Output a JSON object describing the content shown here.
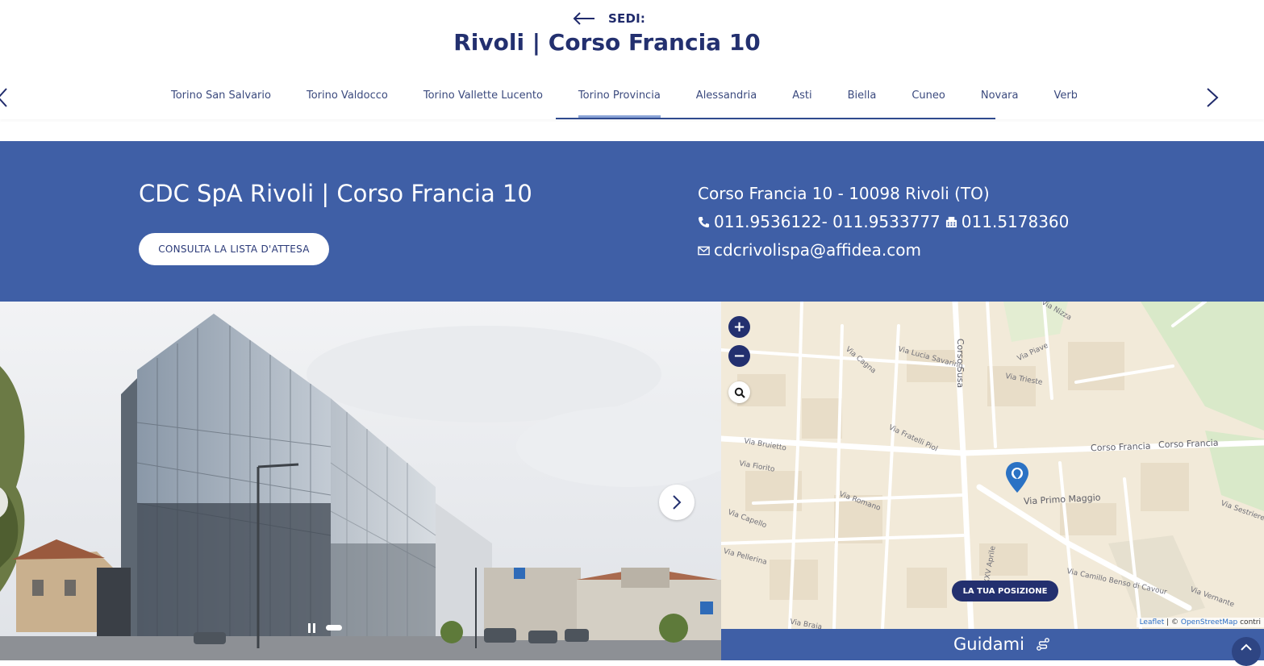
{
  "header": {
    "back_label": "SEDI:",
    "title": "Rivoli | Corso Francia 10"
  },
  "tabs": {
    "items": [
      {
        "label": "Torino San Salvario"
      },
      {
        "label": "Torino Valdocco"
      },
      {
        "label": "Torino Vallette Lucento"
      },
      {
        "label": "Torino Provincia"
      },
      {
        "label": "Alessandria"
      },
      {
        "label": "Asti"
      },
      {
        "label": "Biella"
      },
      {
        "label": "Cuneo"
      },
      {
        "label": "Novara"
      },
      {
        "label": "Verbania"
      }
    ],
    "active": "Torino Provincia"
  },
  "location": {
    "name": "CDC SpA Rivoli | Corso Francia 10",
    "waitlist_button": "CONSULTA LA LISTA D'ATTESA",
    "address": "Corso Francia 10 - 10098 Rivoli (TO)",
    "phones": "011.9536122- 011.9533777",
    "fax": "011.5178360",
    "email": "cdcrivolispa@affidea.com"
  },
  "map": {
    "zoom_in": "+",
    "zoom_out": "−",
    "position_button": "LA TUA POSIZIONE",
    "attribution_leaflet": "Leaflet",
    "attribution_sep": " | © ",
    "attribution_osm": "OpenStreetMap",
    "attribution_tail": " contri",
    "streets": {
      "corso_francia_1": "Corso Francia",
      "corso_francia_2": "Corso Francia",
      "via_primo_maggio": "Via Primo Maggio",
      "corso_susa": "Corso Susa",
      "via_lucia_savarino": "Via Lucia Savarino",
      "via_trieste": "Via Trieste",
      "via_piave": "Via Piave",
      "via_nizza": "Via Nizza",
      "via_romano": "Via Romano",
      "via_capello": "Via Capello",
      "via_fiorito": "Via Fiorito",
      "via_bruietto": "Via Bruietto",
      "via_fratelli_piol": "Via Fratelli Piol",
      "via_camillo_benso": "Via Camillo Benso di Cavour",
      "via_vernante": "Via Vernante",
      "via_xx_aprile": "Via XXV Aprile",
      "via_cagna": "Via Cagna",
      "via_sestriere": "Via Sestriere",
      "via_braia": "Via Braia",
      "via_pellerina": "Via Pellerina"
    }
  },
  "guidami": {
    "label": "Guidami"
  },
  "colors": {
    "brand_blue": "#3f5fa6",
    "navy": "#23306f"
  }
}
